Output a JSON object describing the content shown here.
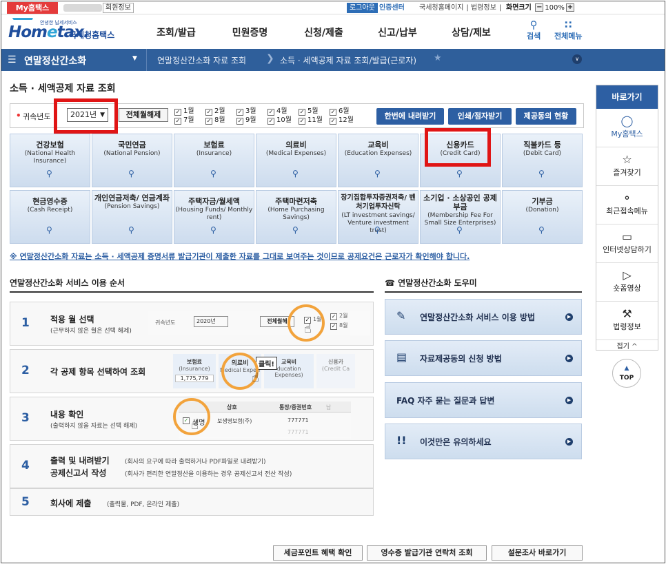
{
  "topbar": {
    "my_label": "My홈택스",
    "member_info": "회원정보",
    "logout": "로그아웃",
    "cert_center": "인증센터",
    "links": [
      "국세청홈페이지",
      "법령정보"
    ],
    "zoom_label": "화면크기",
    "zoom_minus": "−",
    "zoom_value": "100%",
    "zoom_plus": "+"
  },
  "logo": {
    "tagline": "안녕한 납세서비스",
    "word": "Hometax",
    "kr": "국세청홈택스"
  },
  "gnb": [
    "조회/발급",
    "민원증명",
    "신청/제출",
    "신고/납부",
    "상담/제보"
  ],
  "header_tools": {
    "search": "검색",
    "all_menu": "전체메뉴"
  },
  "nav": {
    "title": "연말정산간소화",
    "crumbs": [
      "연말정산간소화 자료 조회",
      "소득 · 세액공제 자료 조회/발급(근로자)"
    ]
  },
  "page_title": "소득 · 세액공제 자료 조회",
  "year_bar": {
    "label": "귀속년도",
    "selected_year": "2021년",
    "clear_all": "전체월해제",
    "months": [
      {
        "label": "1월",
        "checked": true
      },
      {
        "label": "2월",
        "checked": true
      },
      {
        "label": "3월",
        "checked": true
      },
      {
        "label": "4월",
        "checked": true
      },
      {
        "label": "5월",
        "checked": true
      },
      {
        "label": "6월",
        "checked": true
      },
      {
        "label": "7월",
        "checked": true
      },
      {
        "label": "8월",
        "checked": true
      },
      {
        "label": "9월",
        "checked": true
      },
      {
        "label": "10월",
        "checked": true
      },
      {
        "label": "11월",
        "checked": true
      },
      {
        "label": "12월",
        "checked": true
      }
    ],
    "btn_download": "한번에 내려받기",
    "btn_print": "인쇄/점자받기",
    "btn_status": "제공동의 현황"
  },
  "tiles": [
    {
      "ko": "건강보험",
      "en": "(National Health Insurance)"
    },
    {
      "ko": "국민연금",
      "en": "(National Pension)"
    },
    {
      "ko": "보험료",
      "en": "(Insurance)"
    },
    {
      "ko": "의료비",
      "en": "(Medical Expenses)"
    },
    {
      "ko": "교육비",
      "en": "(Education Expenses)"
    },
    {
      "ko": "신용카드",
      "en": "(Credit Card)"
    },
    {
      "ko": "직불카드 등",
      "en": "(Debit Card)"
    },
    {
      "ko": "현금영수증",
      "en": "(Cash Receipt)"
    },
    {
      "ko": "개인연금저축/ 연금계좌",
      "en": "(Pension Savings)"
    },
    {
      "ko": "주택자금/월세액",
      "en": "(Housing Funds/ Monthly rent)"
    },
    {
      "ko": "주택마련저축",
      "en": "(Home Purchasing Savings)"
    },
    {
      "ko": "장기집합투자증권저축/ 벤처기업투자신탁",
      "en": "(LT investment savings/ Venture investment trust)"
    },
    {
      "ko": "소기업 · 소상공인 공제부금",
      "en": "(Membership Fee For Small Size Enterprises)"
    },
    {
      "ko": "기부금",
      "en": "(Donation)"
    }
  ],
  "notice": "※ 연말정산간소화 자료는 소득 · 세액공제 증명서류 발급기관이 제출한 자료를 그대로 보여주는 것이므로 공제요건은 근로자가 확인해야 합니다.",
  "steps_title": "연말정산간소화 서비스 이용 순서",
  "help_title": "연말정산간소화 도우미",
  "steps": [
    {
      "num": "1",
      "title": "적용 월 선택",
      "desc": "(근무하지 않은 월은 선택 해제)"
    },
    {
      "num": "2",
      "title": "각 공제 항목 선택하여 조회",
      "desc": ""
    },
    {
      "num": "3",
      "title": "내용 확인",
      "desc": "(출력하지 않을 자료는 선택 해제)"
    },
    {
      "num": "4",
      "title": "출력 및 내려받기",
      "desc": "(회사의 요구에 따라 출력하거나 PDF파일로 내려받기)",
      "title2": "공제신고서 작성",
      "desc2": "(회사가 편리한 연말정산을 이용하는 경우 공제신고서 전산 작성)"
    },
    {
      "num": "5",
      "title": "회사에 제출",
      "desc": "(출력물, PDF, 온라인 제출)"
    }
  ],
  "step_mocks": {
    "s1_label": "귀속년도",
    "s1_year": "2020년",
    "s1_clear": "전체월해",
    "s1_month1": "1월",
    "s1_month2": "2월",
    "s1_month8": "8월",
    "s2_t1": "보험료",
    "s2_t1en": "(Insurance)",
    "s2_amount": "1,775,779",
    "s2_t2": "의료비",
    "s2_t2en": "Medical Expen",
    "s2_click": "클릭!",
    "s2_t3": "교육비",
    "s2_t3en": "ducation Expenses)",
    "s2_t4": "신용카",
    "s2_t4en": "(Credit Ca",
    "s3_h1": "상호",
    "s3_h2": "통장/증권번호",
    "s3_h3": "납",
    "s3_r1a": "생명",
    "s3_r1b": "보생명보험(주)",
    "s3_r1c": "777771",
    "s3_r2c": "777771"
  },
  "help_items": [
    {
      "icon": "manual-icon",
      "label": "연말정산간소화 서비스 이용 방법"
    },
    {
      "icon": "document-icon",
      "label": "자료제공동의 신청 방법"
    },
    {
      "icon": "faq-icon",
      "label": "FAQ 자주 묻는 질문과 답변"
    },
    {
      "icon": "caution-icon",
      "label": "이것만은 유의하세요"
    }
  ],
  "bottom_buttons": [
    "세금포인트 혜택 확인",
    "영수증 발급기관 연락처 조회",
    "설문조사 바로가기"
  ],
  "quick": {
    "title": "바로가기",
    "items": [
      {
        "icon": "person-icon",
        "label": "My홈택스"
      },
      {
        "icon": "star-icon",
        "label": "즐겨찾기"
      },
      {
        "icon": "recent-icon",
        "label": "최근접속메뉴"
      },
      {
        "icon": "monitor-icon",
        "label": "인터넷상담하기"
      },
      {
        "icon": "play-icon",
        "label": "숏폼영상"
      },
      {
        "icon": "gavel-icon",
        "label": "법령정보"
      }
    ],
    "fold": "접기 ^"
  },
  "top_button": "TOP",
  "colors": {
    "primary": "#2d5fa3",
    "nav": "#2f5f9b",
    "highlight": "#e01515",
    "badge": "#e43b3b"
  }
}
